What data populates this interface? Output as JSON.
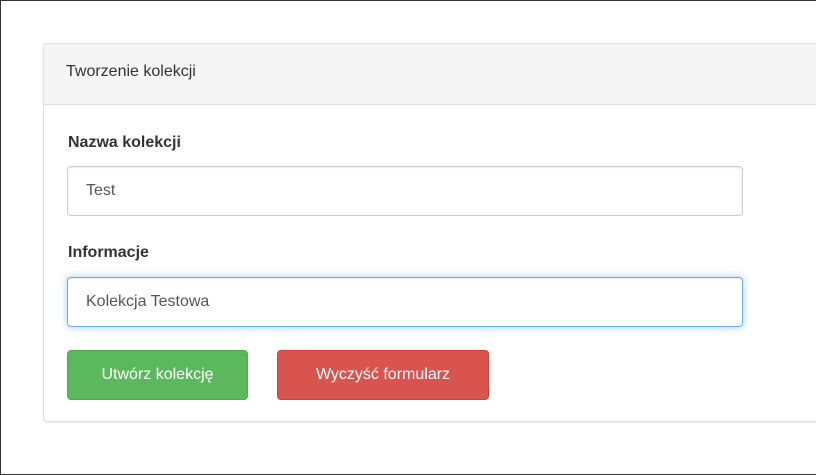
{
  "panel": {
    "title": "Tworzenie kolekcji"
  },
  "form": {
    "name_label": "Nazwa kolekcji",
    "name_value": "Test",
    "info_label": "Informacje",
    "info_value": "Kolekcja Testowa"
  },
  "buttons": {
    "create_label": "Utwórz kolekcję",
    "clear_label": "Wyczyść formularz"
  },
  "colors": {
    "success": "#5cb85c",
    "danger": "#d9534f",
    "focus_border": "#66afe9",
    "panel_heading_bg": "#f5f5f5"
  }
}
